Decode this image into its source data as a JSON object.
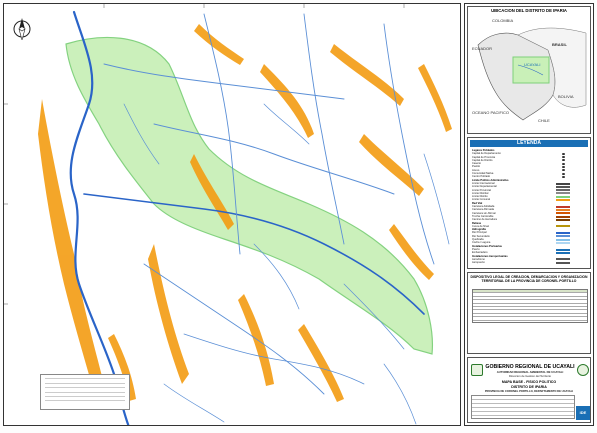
{
  "map": {
    "title": "MAPA BASE - FISICO POLITICO",
    "district": "DISTRITO DE IPARIA",
    "province_line": "PROVINCIA DE CORONEL PORTILLO, DEPARTAMENTO DE UCAYALI",
    "colors": {
      "territory": "#c9f0b8",
      "territory_edge": "#7ed07a",
      "river_main": "#2a64c8",
      "river_minor": "#5b8fd6",
      "native_community": "#f39c12",
      "background": "#ffffff"
    }
  },
  "inset": {
    "title": "UBICACION DEL DISTRITO DE IPARIA",
    "labels": [
      "COLOMBIA",
      "ECUADOR",
      "BRASIL",
      "UCAYALI",
      "BOLIVIA",
      "CHILE",
      "OCEANO PACIFICO"
    ]
  },
  "legend": {
    "title": "LEYENDA",
    "rows": [
      {
        "label": "Lugares Poblados",
        "group": true,
        "color": ""
      },
      {
        "label": "Capital de Departamento",
        "group": false,
        "color": "#333333"
      },
      {
        "label": "Capital de Provincia",
        "group": false,
        "color": "#333333"
      },
      {
        "label": "Capital de Distrito",
        "group": false,
        "color": "#333333"
      },
      {
        "label": "Caserio",
        "group": false,
        "color": "#333333"
      },
      {
        "label": "Pueblo",
        "group": false,
        "color": "#333333"
      },
      {
        "label": "Anexo",
        "group": false,
        "color": "#333333"
      },
      {
        "label": "Comunidad Nativa",
        "group": false,
        "color": "#333333"
      },
      {
        "label": "Centro Poblado",
        "group": false,
        "color": "#333333"
      },
      {
        "label": "Limite Politico Administrativo",
        "group": true,
        "color": ""
      },
      {
        "label": "Limite Internacional",
        "group": false,
        "color": "#444444"
      },
      {
        "label": "Limite Departamental",
        "group": false,
        "color": "#555555"
      },
      {
        "label": "Limite Provincial",
        "group": false,
        "color": "#666666"
      },
      {
        "label": "Limite Distrital",
        "group": false,
        "color": "#888888"
      },
      {
        "label": "Limite Distrito",
        "group": false,
        "color": "#7ed07a"
      },
      {
        "label": "Limite Comunal",
        "group": false,
        "color": "#f39c12"
      },
      {
        "label": "Red Vial",
        "group": true,
        "color": ""
      },
      {
        "label": "Carretera Asfaltada",
        "group": false,
        "color": "#c0392b"
      },
      {
        "label": "Carretera Afirmada",
        "group": false,
        "color": "#e67e22"
      },
      {
        "label": "Carretera sin Afirmar",
        "group": false,
        "color": "#d35400"
      },
      {
        "label": "Trocha Carrozable",
        "group": false,
        "color": "#a04000"
      },
      {
        "label": "Camino de Herradura",
        "group": false,
        "color": "#7b3f00"
      },
      {
        "label": "Relieve",
        "group": true,
        "color": ""
      },
      {
        "label": "Curva de Nivel",
        "group": false,
        "color": "#b7950b"
      },
      {
        "label": "Hidrografia",
        "group": true,
        "color": ""
      },
      {
        "label": "Rio Principal",
        "group": false,
        "color": "#2a64c8"
      },
      {
        "label": "Rio Secundario",
        "group": false,
        "color": "#5b8fd6"
      },
      {
        "label": "Quebrada",
        "group": false,
        "color": "#85c1e9"
      },
      {
        "label": "Cocha / Laguna",
        "group": false,
        "color": "#aed6f1"
      },
      {
        "label": "Instalaciones Portuarias",
        "group": true,
        "color": ""
      },
      {
        "label": "Puerto",
        "group": false,
        "color": "#1a6fb5"
      },
      {
        "label": "Embarcadero",
        "group": false,
        "color": "#1a6fb5"
      },
      {
        "label": "Instalaciones Aeroportuarias",
        "group": true,
        "color": ""
      },
      {
        "label": "Aerodromo",
        "group": false,
        "color": "#555555"
      },
      {
        "label": "Aeropuerto",
        "group": false,
        "color": "#555555"
      }
    ]
  },
  "legal": {
    "title": "DISPOSITIVO LEGAL DE CREACION, DEMARCACION Y ORGANIZACION TERRITORIAL DE LA PROVINCIA DE CORONEL PORTILLO"
  },
  "title_block": {
    "government": "GOBIERNO REGIONAL DE UCAYALI",
    "authority": "AUTORIDAD REGIONAL AMBIENTAL DE UCAYALI",
    "division": "Direccion de Gestion del Territorio",
    "ide": "IDE"
  }
}
